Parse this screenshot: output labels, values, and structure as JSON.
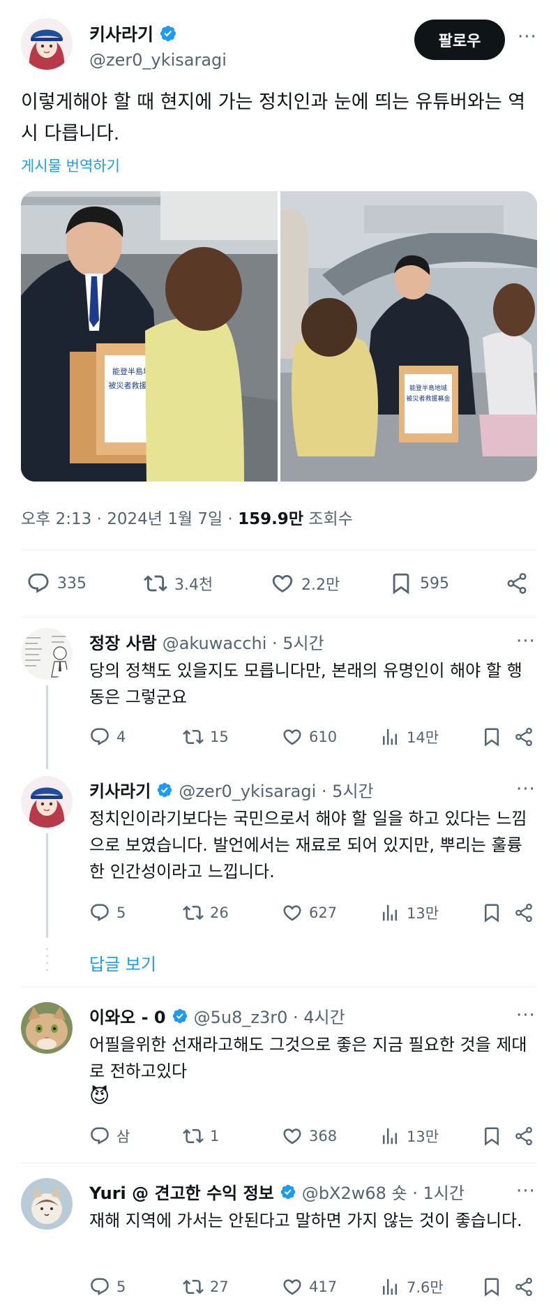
{
  "tweet": {
    "author_name": "키사라기",
    "author_handle": "@zer0_ykisaragi",
    "follow_label": "팔로우",
    "more": "···",
    "text": "이렇게해야 할 때 현지에 가는 정치인과 눈에 띄는 유튜버와는 역시 다릅니다.",
    "translate": "게시물 번역하기",
    "time": "오후 2:13 · 2024년 1월 7일 · ",
    "views_count": "159.9만",
    "views_label": " 조회수",
    "photo_sign_1": "能登半島地域\n被災者救援募金",
    "photo_sign_2": "能登半島地域\n被災者救援募金",
    "stats": {
      "replies": "335",
      "retweets": "3.4천",
      "likes": "2.2만",
      "bookmarks": "595"
    }
  },
  "replies": [
    {
      "name": "정장 사람",
      "handle": "@akuwacchi · 5시간",
      "verified": false,
      "text": "당의 정책도 있을지도 모릅니다만, 본래의 유명인이 해야 할 행동은 그렇군요",
      "replies": "4",
      "retweets": "15",
      "likes": "610",
      "views": "14만"
    },
    {
      "name": "키사라기",
      "handle": "@zer0_ykisaragi · 5시간",
      "verified": true,
      "text": "정치인이라기보다는 국민으로서 해야 할 일을 하고 있다는 느낌으로 보였습니다. 발언에서는 재료로 되어 있지만, 뿌리는 훌륭한 인간성이라고 느낍니다.",
      "replies": "5",
      "retweets": "26",
      "likes": "627",
      "views": "13만"
    },
    {
      "name": "이와오 - 0",
      "handle": "@5u8_z3r0 · 4시간",
      "verified": true,
      "text": "어필을위한 선재라고해도 그것으로 좋은 지금 필요한 것을 제대로 전하고있다",
      "emoji": "😈",
      "replies": "삼",
      "retweets": "1",
      "likes": "368",
      "views": "13만"
    },
    {
      "name": "Yuri @ 견고한 수익 정보",
      "handle": "@bX2w68 숏 · 1시간",
      "verified": true,
      "text": "재해 지역에 가서는 안된다고 말하면 가지 않는 것이 좋습니다.",
      "replies": "5",
      "retweets": "27",
      "likes": "417",
      "views": "7.6만"
    }
  ],
  "show_replies": "답글 보기",
  "colors": {
    "accent": "#1d9bf0",
    "text": "#0f1419",
    "muted": "#536471",
    "divider": "#eff3f4"
  }
}
